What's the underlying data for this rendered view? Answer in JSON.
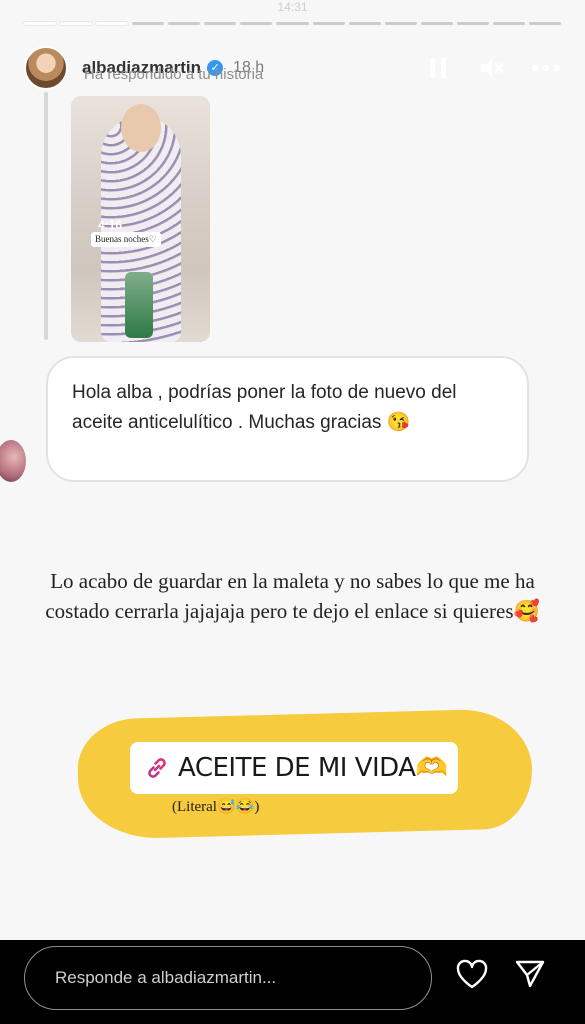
{
  "status_bar": {
    "time": "14:31"
  },
  "progress": {
    "total_segments": 15,
    "completed_segments": 3
  },
  "header": {
    "username": "albadiazmartin",
    "verified_icon": "verified-badge-icon",
    "time_ago": "18 h",
    "icons": [
      "pause-icon",
      "mute-icon",
      "more-icon"
    ]
  },
  "reply_context": {
    "label": "Ha respondido a tu historia",
    "thumbnail": {
      "time_text": "4:16",
      "sticker_text": "Buenas noches♡"
    }
  },
  "message": {
    "text": "Hola alba , podrías poner la foto de nuevo del aceite anticelulítico  . Muchas gracias 😘"
  },
  "caption": {
    "text": "Lo acabo de guardar en la maleta y no sabes lo que me ha costado cerrarla jajajaja pero te dejo el enlace si quieres🥰"
  },
  "link_sticker": {
    "icon": "link-icon",
    "label": "ACEITE DE MI VIDA🫶"
  },
  "note": {
    "text": "(Literal😅😂)"
  },
  "colors": {
    "highlight": "#f6cb3e",
    "link_icon": "#c13584",
    "verified": "#3797f0"
  },
  "reply_bar": {
    "placeholder": "Responde a albadiazmartin...",
    "icons": [
      "heart-icon",
      "send-icon"
    ]
  }
}
